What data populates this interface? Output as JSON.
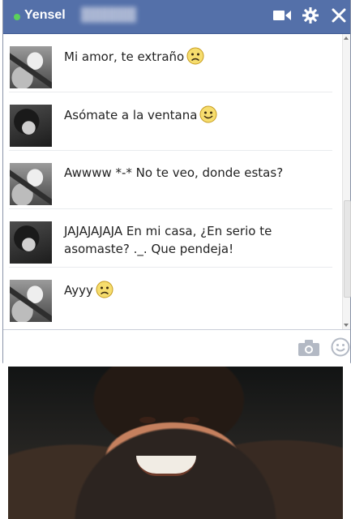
{
  "header": {
    "contact_name": "Yensel",
    "status_color": "#5bd15b",
    "bar_color": "#5470a9",
    "icons": [
      "video-camera-icon",
      "gear-icon",
      "close-icon"
    ]
  },
  "messages": [
    {
      "sender": "girl",
      "avatar": "guitar-photo",
      "text": "Mi amor, te extraño",
      "emoticon": "sad-face"
    },
    {
      "sender": "yensel",
      "avatar": "man-photo",
      "text": "Asómate a la ventana",
      "emoticon": "smile-face"
    },
    {
      "sender": "girl",
      "avatar": "guitar-photo",
      "text": "Awwww *-* No te veo, donde estas?",
      "emoticon": null
    },
    {
      "sender": "yensel",
      "avatar": "man-photo",
      "text": "JAJAJAJAJA En mi casa, ¿En serio te asomaste? ._. Que pendeja!",
      "emoticon": null
    },
    {
      "sender": "girl",
      "avatar": "guitar-photo",
      "text": "Ayyy",
      "emoticon": "sad-face"
    }
  ],
  "composer": {
    "icons": [
      "camera-icon",
      "emoji-icon"
    ]
  },
  "image": {
    "description_icon": "smiling-man-reaction-photo"
  }
}
